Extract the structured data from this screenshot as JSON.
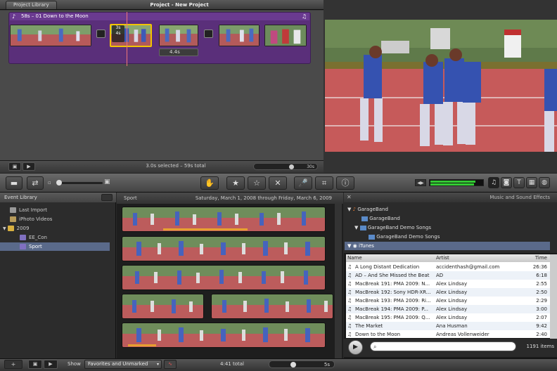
{
  "project": {
    "library_tab": "Project Library",
    "title": "Project - New Project",
    "music_label": "58s – 01 Down to the Moon",
    "clip_duration": "4.4s",
    "clip_marker_a": "3s",
    "clip_marker_b": "4s",
    "status": "3.0s selected – 59s total",
    "zoom_label": "30s"
  },
  "event_library": {
    "header": "Event Library",
    "items": [
      {
        "label": "Last Import"
      },
      {
        "label": "iPhoto Videos"
      },
      {
        "label": "2009"
      },
      {
        "label": "EE_Con"
      },
      {
        "label": "Sport"
      }
    ]
  },
  "browser": {
    "event_name": "Sport",
    "date_range": "Saturday, March 1, 2008 through Friday, March 6, 2009"
  },
  "music": {
    "header": "Music and Sound Effects",
    "tree": [
      {
        "label": "GarageBand"
      },
      {
        "label": "GarageBand"
      },
      {
        "label": "GarageBand Demo Songs"
      },
      {
        "label": "GarageBand Demo Songs"
      },
      {
        "label": "iTunes"
      }
    ],
    "columns": {
      "name": "Name",
      "artist": "Artist",
      "time": "Time"
    },
    "rows": [
      {
        "name": "A Long Distant Dedication",
        "artist": "accidenthash@gmail.com",
        "time": "26:36"
      },
      {
        "name": "AD – And She Missed the Beat",
        "artist": "AD",
        "time": "6:18"
      },
      {
        "name": "MacBreak 191: PMA 2009: N...",
        "artist": "Alex Lindsay",
        "time": "2:55"
      },
      {
        "name": "MacBreak 192: Sony HDR-XR...",
        "artist": "Alex Lindsay",
        "time": "2:50"
      },
      {
        "name": "MacBreak 193: PMA 2009: Ri...",
        "artist": "Alex Lindsay",
        "time": "2:29"
      },
      {
        "name": "MacBreak 194: PMA 2009: P...",
        "artist": "Alex Lindsay",
        "time": "3:00"
      },
      {
        "name": "MacBreak 195: PMA 2009: Q...",
        "artist": "Alex Lindsay",
        "time": "2:07"
      },
      {
        "name": "The Market",
        "artist": "Ana Husman",
        "time": "9:42"
      },
      {
        "name": "Down to the Moon",
        "artist": "Andreas Vollenweider",
        "time": "2:40"
      }
    ],
    "item_count": "1191 items",
    "search_placeholder": ""
  },
  "bottom": {
    "show_label": "Show",
    "show_value": "Favorites and Unmarked",
    "total": "4:41 total",
    "zoom_label": "5s"
  },
  "colors": {
    "music_track": "#5a2f7a",
    "selection": "#f2c500",
    "sidebar_selected": "#5a6a8a"
  }
}
